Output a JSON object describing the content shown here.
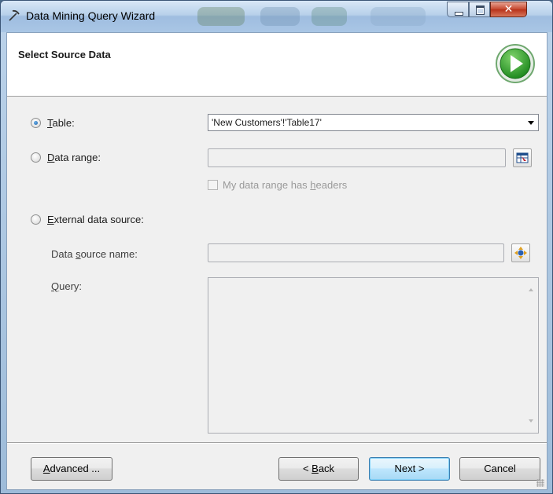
{
  "window": {
    "title": "Data Mining Query Wizard"
  },
  "header": {
    "title": "Select Source Data",
    "icon": "green-play-icon"
  },
  "source": {
    "table_label_underlined": "T",
    "table_label_rest": "able:",
    "table_selected": true,
    "table_value": "'New Customers'!'Table17'",
    "data_range_label_underlined": "D",
    "data_range_label_rest": "ata range:",
    "data_range_value": "",
    "headers_check_prefix": "My data range has ",
    "headers_check_underlined": "h",
    "headers_check_suffix": "eaders",
    "external_label_underlined": "E",
    "external_label_rest": "xternal data source:",
    "ds_name_prefix": "Data ",
    "ds_name_underlined": "s",
    "ds_name_suffix": "ource name:",
    "ds_name_value": "",
    "query_underlined": "Q",
    "query_rest": "uery:",
    "query_value": ""
  },
  "buttons": {
    "advanced_underlined": "A",
    "advanced_rest": "dvanced ...",
    "back_prefix": "< ",
    "back_underlined": "B",
    "back_suffix": "ack",
    "next": "Next >",
    "cancel": "Cancel"
  },
  "colors": {
    "accent": "#3c7fb1",
    "play_green": "#2f9e2f"
  }
}
